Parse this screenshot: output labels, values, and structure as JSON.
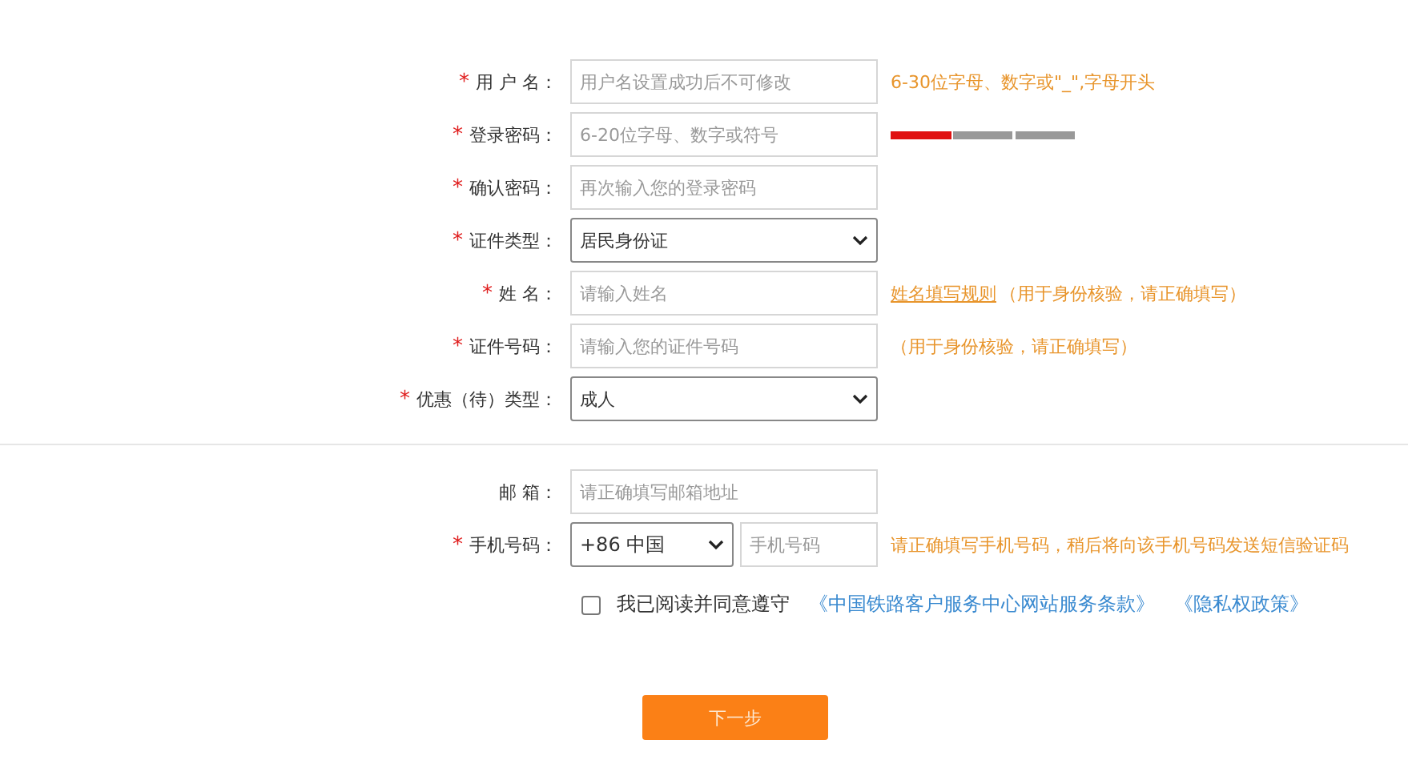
{
  "form": {
    "fields": [
      {
        "kind": "input",
        "mark": "*",
        "label": "用 户 名：",
        "placeholder": "用户名设置成功后不可修改",
        "hint": "6-30位字母、数字或\"_\",字母开头"
      },
      {
        "kind": "password",
        "mark": "*",
        "label": "登录密码：",
        "placeholder": "6-20位字母、数字或符号",
        "strength": {
          "level": 0.33
        }
      },
      {
        "kind": "input",
        "mark": "*",
        "label": "确认密码：",
        "placeholder": "再次输入您的登录密码"
      },
      {
        "kind": "select",
        "mark": "*",
        "label": "证件类型：",
        "value": "居民身份证"
      },
      {
        "kind": "input",
        "mark": "*",
        "label": "姓 名：",
        "placeholder": "请输入姓名",
        "hint_link": "姓名填写规则",
        "hint": "（用于身份核验，请正确填写）"
      },
      {
        "kind": "input",
        "mark": "*",
        "label": "证件号码：",
        "placeholder": "请输入您的证件号码",
        "hint": "（用于身份核验，请正确填写）"
      },
      {
        "kind": "select",
        "mark": "*",
        "label": "优惠（待）类型：",
        "value": "成人"
      }
    ],
    "contact": [
      {
        "kind": "input",
        "label": "邮 箱：",
        "placeholder": "请正确填写邮箱地址"
      },
      {
        "kind": "phone",
        "mark": "*",
        "label": "手机号码：",
        "country": "+86 中国",
        "placeholder": "手机号码",
        "hint": "请正确填写手机号码，稍后将向该手机号码发送短信验证码"
      }
    ],
    "agreement": {
      "checked": false,
      "text": "我已阅读并同意遵守",
      "links": [
        "《中国铁路客户服务中心网站服务条款》",
        "《隐私权政策》"
      ]
    },
    "next_button": "下一步"
  }
}
